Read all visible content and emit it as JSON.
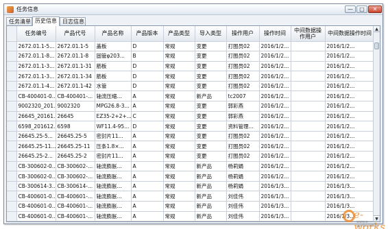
{
  "window": {
    "title": "任务信息",
    "controls": {
      "minimize": "—",
      "maximize": "□",
      "close": "✕"
    }
  },
  "tabs": [
    {
      "label": "任务清单",
      "active": false
    },
    {
      "label": "历史信息",
      "active": true
    },
    {
      "label": "日志信息",
      "active": false
    }
  ],
  "table": {
    "columns": [
      "任务编号",
      "产品代号",
      "产品名称",
      "产品版本",
      "产品类型",
      "导入类型",
      "操作用户",
      "操作时间",
      "中间数据操作用户",
      "中间数据操作时间"
    ],
    "rows": [
      [
        "2672.01.1-5...",
        "2672.01.1-5",
        "盖板",
        "D",
        "常规",
        "变更",
        "打图员02",
        "2016/1/2...",
        "",
        "2016/1/2..."
      ],
      [
        "2672.01.1-8...",
        "2672.01.1-8",
        "固管φ203...",
        "B",
        "常规",
        "变更",
        "打图员02",
        "2016/1/2...",
        "",
        "2016/1/2..."
      ],
      [
        "2672.01.1-3...",
        "2672.01.1-31",
        "筋板",
        "D",
        "常规",
        "变更",
        "打图员02",
        "2016/1/2...",
        "",
        "2016/1/2..."
      ],
      [
        "2672.01.1-3...",
        "2672.01.1-34",
        "筋板",
        "D",
        "常规",
        "变更",
        "打图员02",
        "2016/1/2...",
        "",
        "2016/1/2..."
      ],
      [
        "2672.01.1-4...",
        "2672.01.1-42",
        "水管",
        "D",
        "常规",
        "变更",
        "打图员02",
        "2016/1/2...",
        "",
        "2016/1/2..."
      ],
      [
        "CB-400401-0...",
        "CB-400401-...",
        "轴流压缩...",
        "A",
        "常规",
        "新产品",
        "tc2007",
        "2016/1/2...",
        "",
        "2016/1/2..."
      ],
      [
        "9002320_201...",
        "9002320",
        "MPG26.8-3...",
        "A",
        "常规",
        "变更",
        "郭彩燕",
        "2016/1/2...",
        "",
        "2016/1/2..."
      ],
      [
        "26645_20161...",
        "26645",
        "EZ35-2+2+...",
        "C",
        "常规",
        "变更",
        "郭彩燕",
        "2016/1/2...",
        "",
        "2016/1/2..."
      ],
      [
        "6598_201612...",
        "6598",
        "WF11.4-95...",
        "D",
        "常规",
        "变更",
        "资料管理...",
        "2016/1/2...",
        "",
        "2016/1/2..."
      ],
      [
        "26645.25-5...",
        "26645.25-5",
        "密封片11...",
        "A",
        "常规",
        "变更",
        "打图员02",
        "2016/1/2...",
        "",
        "2016/1/2..."
      ],
      [
        "26645.25-11...",
        "26645.25-11",
        "压条1.8×...",
        "A",
        "常规",
        "变更",
        "打图员02",
        "2016/1/2...",
        "",
        "2016/1/2..."
      ],
      [
        "26645.25-2...",
        "26645.25-2",
        "密封片11...",
        "A",
        "常规",
        "变更",
        "打图员02",
        "2016/1/2...",
        "",
        "2016/1/2..."
      ],
      [
        "CB-300602-0...",
        "CB-300602-...",
        "轴流膨胀...",
        "A",
        "常规",
        "新产品",
        "杨莉娟",
        "2016/1/2...",
        "",
        "2016/1/2..."
      ],
      [
        "CB-300602-0...",
        "CB-300602-...",
        "轴流膨胀...",
        "A",
        "常规",
        "新产品",
        "杨莉娟",
        "2016/1/2...",
        "",
        "2016/1/2..."
      ],
      [
        "CB-300614-3...",
        "CB-300614-...",
        "轴流膨胀...",
        "A",
        "常规",
        "新产品",
        "杨莉娟",
        "2016/1/3...",
        "",
        "2016/1/3..."
      ],
      [
        "CB-400601-0...",
        "CB-400601-...",
        "轴流膨胀...",
        "A",
        "常规",
        "新产品",
        "刘佳伟",
        "2016/1/3...",
        "",
        "2016/1/3..."
      ],
      [
        "CB-400601-0...",
        "CB-400601-...",
        "轴流膨胀...",
        "A",
        "常规",
        "新产品",
        "刘佳伟",
        "2016/1/3...",
        "",
        "2016/1/3..."
      ],
      [
        "CB-400601-0...",
        "CB-400601-...",
        "轴流膨胀...",
        "A",
        "常规",
        "新产品",
        "刘佳伟",
        "2016/1/3...",
        "",
        "2016/1/3..."
      ]
    ]
  },
  "watermark": {
    "brand": "e-works",
    "sub": "www.e-works.net.cn",
    "color": "#f08a2a"
  }
}
